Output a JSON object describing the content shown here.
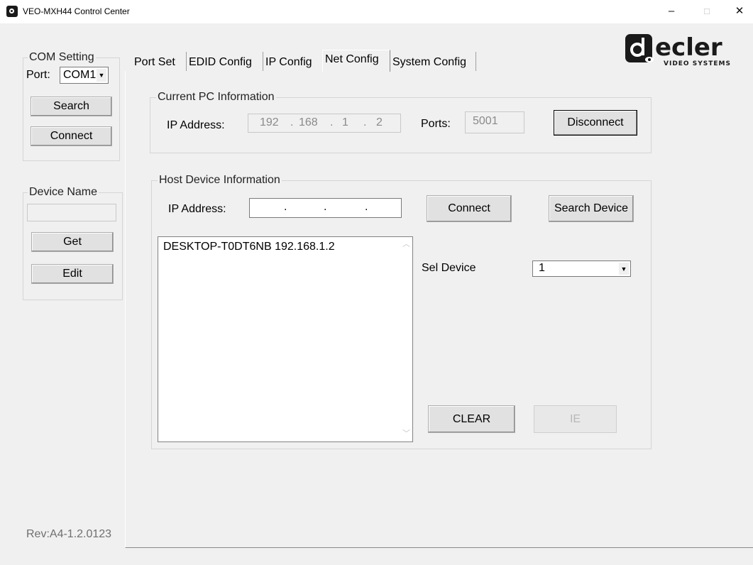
{
  "window": {
    "title": "VEO-MXH44 Control Center",
    "minimize": "–",
    "maximize": "□",
    "close": "✕"
  },
  "logo": {
    "brand": "ecler",
    "sub": "VIDEO SYSTEMS"
  },
  "com_setting": {
    "title": "COM Setting",
    "port_label": "Port:",
    "port_value": "COM1",
    "search_label": "Search",
    "connect_label": "Connect"
  },
  "device_name": {
    "title": "Device Name",
    "value": "",
    "get_label": "Get",
    "edit_label": "Edit"
  },
  "revision": "Rev:A4-1.2.0123",
  "tabs": [
    {
      "label": "Port Set"
    },
    {
      "label": "EDID Config"
    },
    {
      "label": "IP Config"
    },
    {
      "label": "Net Config",
      "active": true
    },
    {
      "label": "System Config"
    }
  ],
  "current_pc": {
    "title": "Current PC Information",
    "ip_label": "IP Address:",
    "ip_octets": [
      "192",
      "168",
      "1",
      "2"
    ],
    "ports_label": "Ports:",
    "ports_value": "5001",
    "disconnect_label": "Disconnect"
  },
  "host_device": {
    "title": "Host Device Information",
    "ip_label": "IP Address:",
    "ip_octets": [
      "",
      "",
      "",
      ""
    ],
    "connect_label": "Connect",
    "search_device_label": "Search Device",
    "list": [
      "DESKTOP-T0DT6NB 192.168.1.2"
    ],
    "sel_device_label": "Sel Device",
    "sel_device_value": "1",
    "clear_label": "CLEAR",
    "ie_label": "IE"
  },
  "icons": {
    "dropdown": "chevron-down-icon",
    "scroll_up": "scroll-up-icon",
    "scroll_down": "scroll-down-icon",
    "app": "ecler-app-icon"
  },
  "colors": {
    "window_bg": "#f0f0f0",
    "titlebar_bg": "#ffffff",
    "disabled_text": "#8a8a8a",
    "logo_dark": "#1a1a1a"
  }
}
